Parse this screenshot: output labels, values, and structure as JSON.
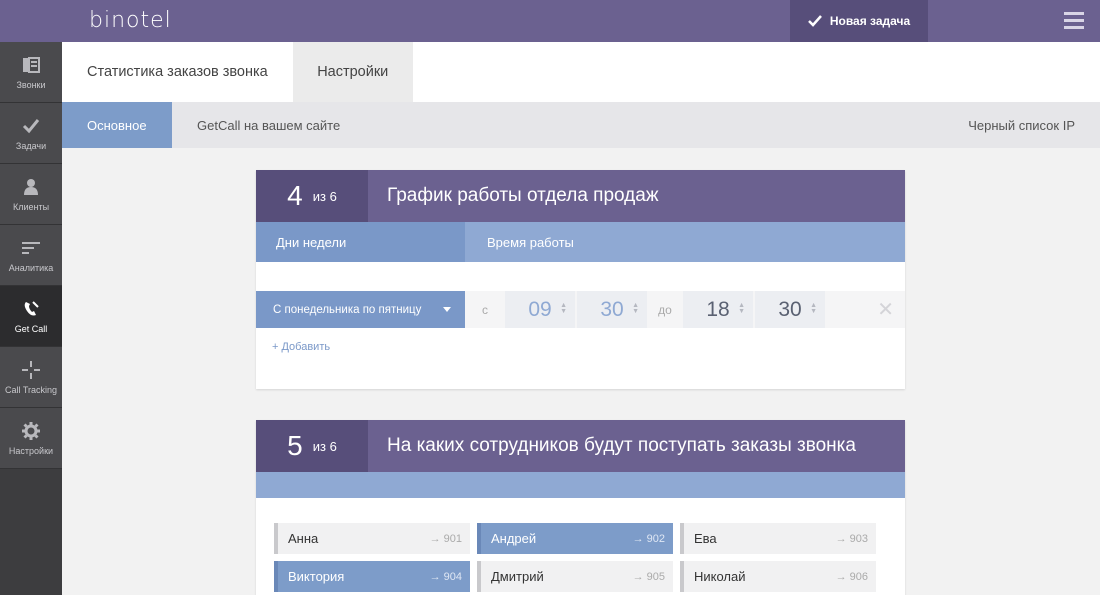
{
  "brand": "binotel",
  "topbar": {
    "new_task": "Новая задача"
  },
  "sidebar": {
    "items": [
      {
        "label": "Звонки"
      },
      {
        "label": "Задачи"
      },
      {
        "label": "Клиенты"
      },
      {
        "label": "Аналитика"
      },
      {
        "label": "Get Call"
      },
      {
        "label": "Call Tracking"
      },
      {
        "label": "Настройки"
      }
    ]
  },
  "tabs": [
    "Статистика заказов звонка",
    "Настройки"
  ],
  "subtabs": {
    "main": "Основное",
    "site": "GetCall на вашем сайте",
    "blacklist": "Черный список IP"
  },
  "card1": {
    "num": "4",
    "of": "из 6",
    "title": "График работы отдела продаж",
    "col_days": "Дни недели",
    "col_time": "Время работы",
    "days_value": "С понедельника по пятницу",
    "from_label": "с",
    "to_label": "до",
    "from_h": "09",
    "from_m": "30",
    "to_h": "18",
    "to_m": "30",
    "add": "+ Добавить"
  },
  "card2": {
    "num": "5",
    "of": "из 6",
    "title": "На каких сотрудников будут поступать заказы звонка",
    "employees": [
      {
        "name": "Анна",
        "ext": "→ 901",
        "selected": false
      },
      {
        "name": "Андрей",
        "ext": "→ 902",
        "selected": true
      },
      {
        "name": "Ева",
        "ext": "→ 903",
        "selected": false
      },
      {
        "name": "Виктория",
        "ext": "→ 904",
        "selected": true
      },
      {
        "name": "Дмитрий",
        "ext": "→ 905",
        "selected": false
      },
      {
        "name": "Николай",
        "ext": "→ 906",
        "selected": false
      }
    ]
  },
  "colors": {
    "purple": "#6b6190",
    "purple_dark": "#574e7a",
    "blue": "#7d9cc9",
    "blue_light": "#8fa9d3"
  }
}
